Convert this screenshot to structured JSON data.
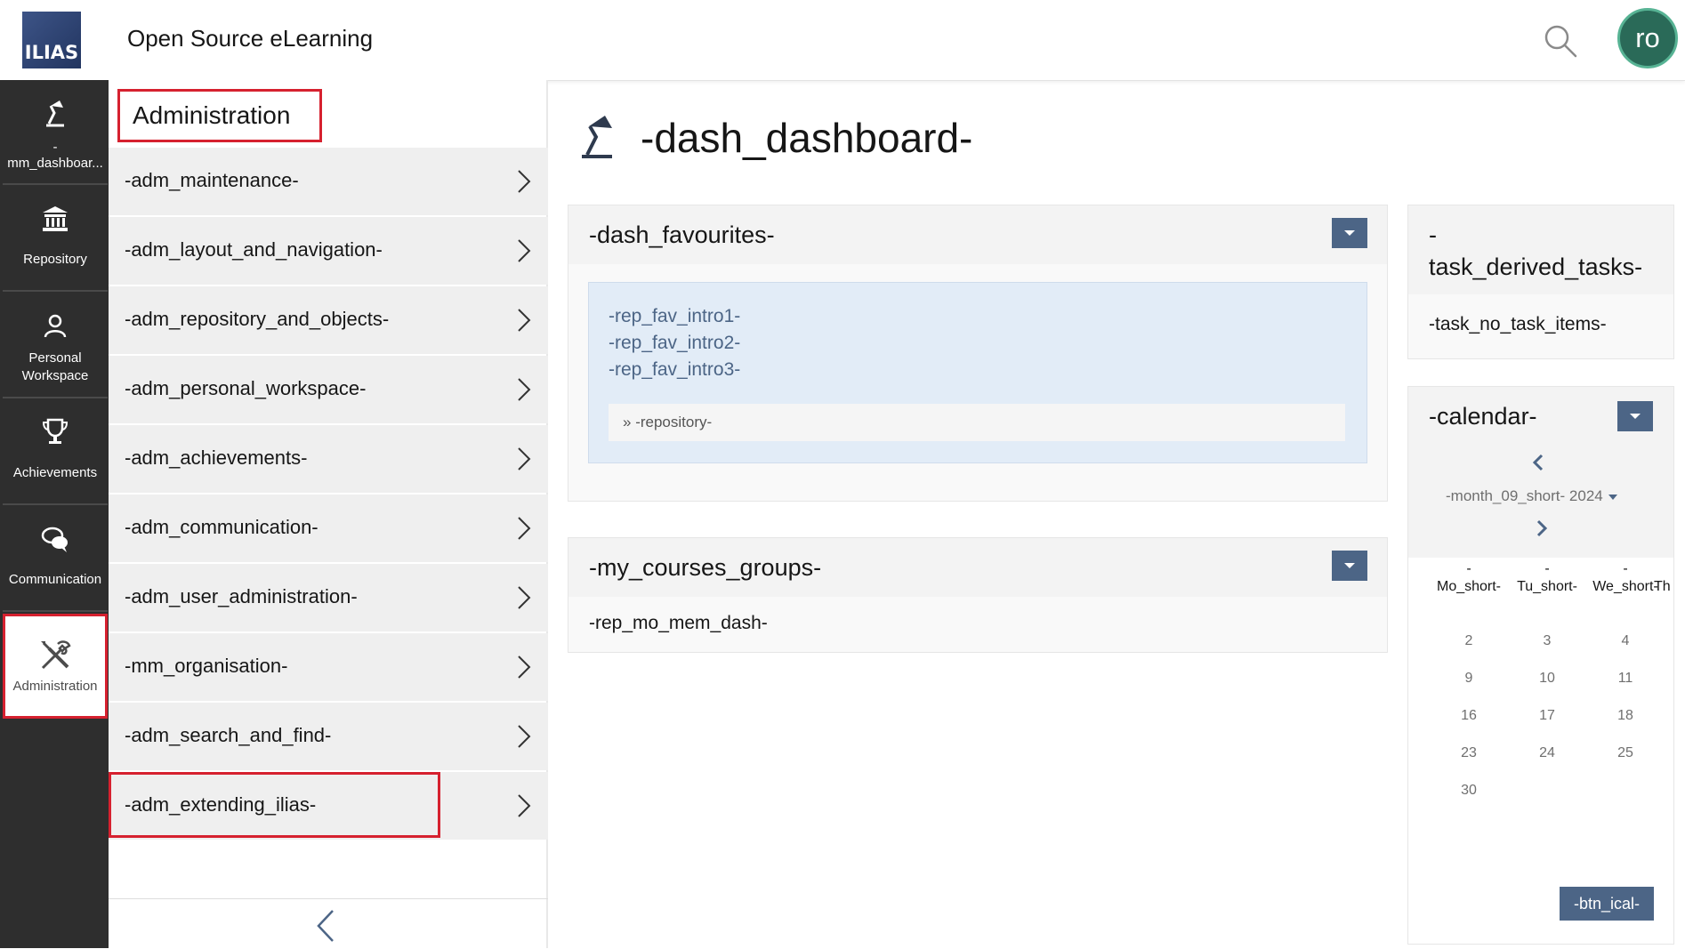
{
  "header": {
    "logo_text": "ILIAS",
    "site_title": "Open Source eLearning",
    "search_icon": "search-icon",
    "avatar_initials": "ro",
    "avatar_color": "#2a6a58"
  },
  "mainbar": {
    "items": [
      {
        "label_line1": "-",
        "label_line2": "mm_dashboar...",
        "icon": "dashboard-lamp-icon"
      },
      {
        "label": "Repository",
        "icon": "repository-icon"
      },
      {
        "label_line1": "Personal",
        "label_line2": "Workspace",
        "icon": "person-icon"
      },
      {
        "label": "Achievements",
        "icon": "trophy-icon"
      },
      {
        "label": "Communication",
        "icon": "chat-bubbles-icon"
      },
      {
        "label": "Administration",
        "icon": "tools-icon",
        "active": true
      }
    ]
  },
  "slate": {
    "title": "Administration",
    "items": [
      "-adm_maintenance-",
      "-adm_layout_and_navigation-",
      "-adm_repository_and_objects-",
      "-adm_personal_workspace-",
      "-adm_achievements-",
      "-adm_communication-",
      "-adm_user_administration-",
      "-mm_organisation-",
      "-adm_search_and_find-",
      "-adm_extending_ilias-"
    ]
  },
  "content": {
    "page_title": "-dash_dashboard-",
    "favourites": {
      "title": "-dash_favourites-",
      "intro": [
        "-rep_fav_intro1-",
        "-rep_fav_intro2-",
        "-rep_fav_intro3-"
      ],
      "repo_prefix": "» ",
      "repo_link": "-repository-"
    },
    "courses": {
      "title": "-my_courses_groups-",
      "text": "-rep_mo_mem_dash-"
    },
    "tasks": {
      "title_line1": "-",
      "title_line2": "task_derived_tasks-",
      "text": "-task_no_task_items-"
    },
    "calendar": {
      "title": "-calendar-",
      "month": "-month_09_short- 2024",
      "weekdays": [
        {
          "dash": "-",
          "label": "Mo_short-"
        },
        {
          "dash": "-",
          "label": "Tu_short-"
        },
        {
          "dash": "-",
          "label": "We_short-"
        },
        {
          "dash": "",
          "label": "Th"
        }
      ],
      "days": [
        [
          "2",
          "3",
          "4"
        ],
        [
          "9",
          "10",
          "11"
        ],
        [
          "16",
          "17",
          "18"
        ],
        [
          "23",
          "24",
          "25"
        ],
        [
          "30",
          "",
          ""
        ]
      ],
      "ical_button": "-btn_ical-"
    }
  },
  "colors": {
    "accent": "#4c6586",
    "highlight_border": "#d6212f",
    "mainbar_bg": "#2e2e2e"
  }
}
